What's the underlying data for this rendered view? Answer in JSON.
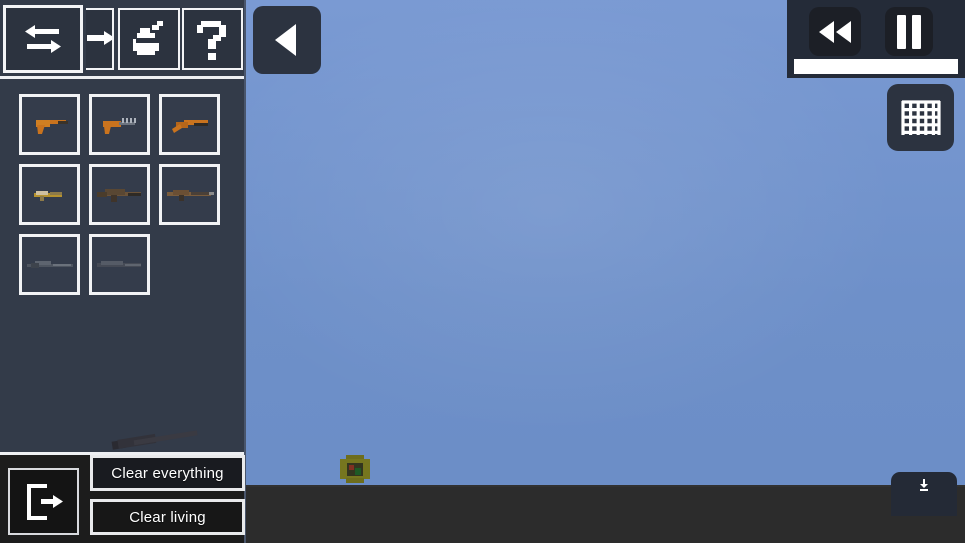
{
  "app": {
    "title": "Sandbox Weapon Editor",
    "colors": {
      "sky_top": "#7a9ad3",
      "sky_bottom": "#6b8dc6",
      "ground": "#2c2c2c",
      "sidebar": "#333b49",
      "panel_border": "#f2f3f5",
      "button_dark": "#2c3340"
    }
  },
  "toolbar": {
    "buttons": [
      {
        "name": "swap-tool",
        "icon": "swap-arrows-icon",
        "label": "Swap",
        "selected": true
      },
      {
        "name": "arrow-tool",
        "icon": "arrow-right-icon",
        "label": "Move",
        "selected": false
      },
      {
        "name": "spray-tool",
        "icon": "spray-can-icon",
        "label": "Spray",
        "selected": false
      },
      {
        "name": "help-tool",
        "icon": "question-mark-icon",
        "label": "Help",
        "selected": false
      }
    ]
  },
  "weapons": {
    "rows": [
      [
        {
          "name": "pistol",
          "label": "Pistol",
          "tint": "#c9731e"
        },
        {
          "name": "machine-pistol",
          "label": "Machine Pistol",
          "tint": "#c9731e"
        },
        {
          "name": "sawed-off-shotgun",
          "label": "Sawed-off Shotgun",
          "tint": "#c9731e"
        }
      ],
      [
        {
          "name": "smg",
          "label": "SMG",
          "tint": "#b5922f"
        },
        {
          "name": "assault-rifle",
          "label": "Assault Rifle",
          "tint": "#6a5238"
        },
        {
          "name": "battle-rifle",
          "label": "Battle Rifle",
          "tint": "#7a5c3c"
        }
      ],
      [
        {
          "name": "sniper-rifle",
          "label": "Sniper Rifle",
          "tint": "#515868"
        },
        {
          "name": "heavy-rifle",
          "label": "Heavy Rifle",
          "tint": "#4a4f5c"
        }
      ]
    ]
  },
  "sidebar_bottom": {
    "exit_button": {
      "label": "Exit",
      "icon": "exit-icon"
    },
    "clear_everything": "Clear everything",
    "clear_living": "Clear living"
  },
  "overlay": {
    "back_button": {
      "label": "Back",
      "icon": "play-left-icon"
    },
    "rewind_button": {
      "label": "Rewind",
      "icon": "rewind-icon"
    },
    "pause_button": {
      "label": "Pause",
      "icon": "pause-icon"
    },
    "grid_button": {
      "label": "Grid snap",
      "icon": "grid-icon"
    },
    "download_button": {
      "label": "Download",
      "icon": "download-icon"
    },
    "timeline": {
      "label": "Timeline",
      "progress": "100"
    }
  },
  "scene": {
    "object": {
      "name": "crate",
      "label": "Crate"
    }
  }
}
